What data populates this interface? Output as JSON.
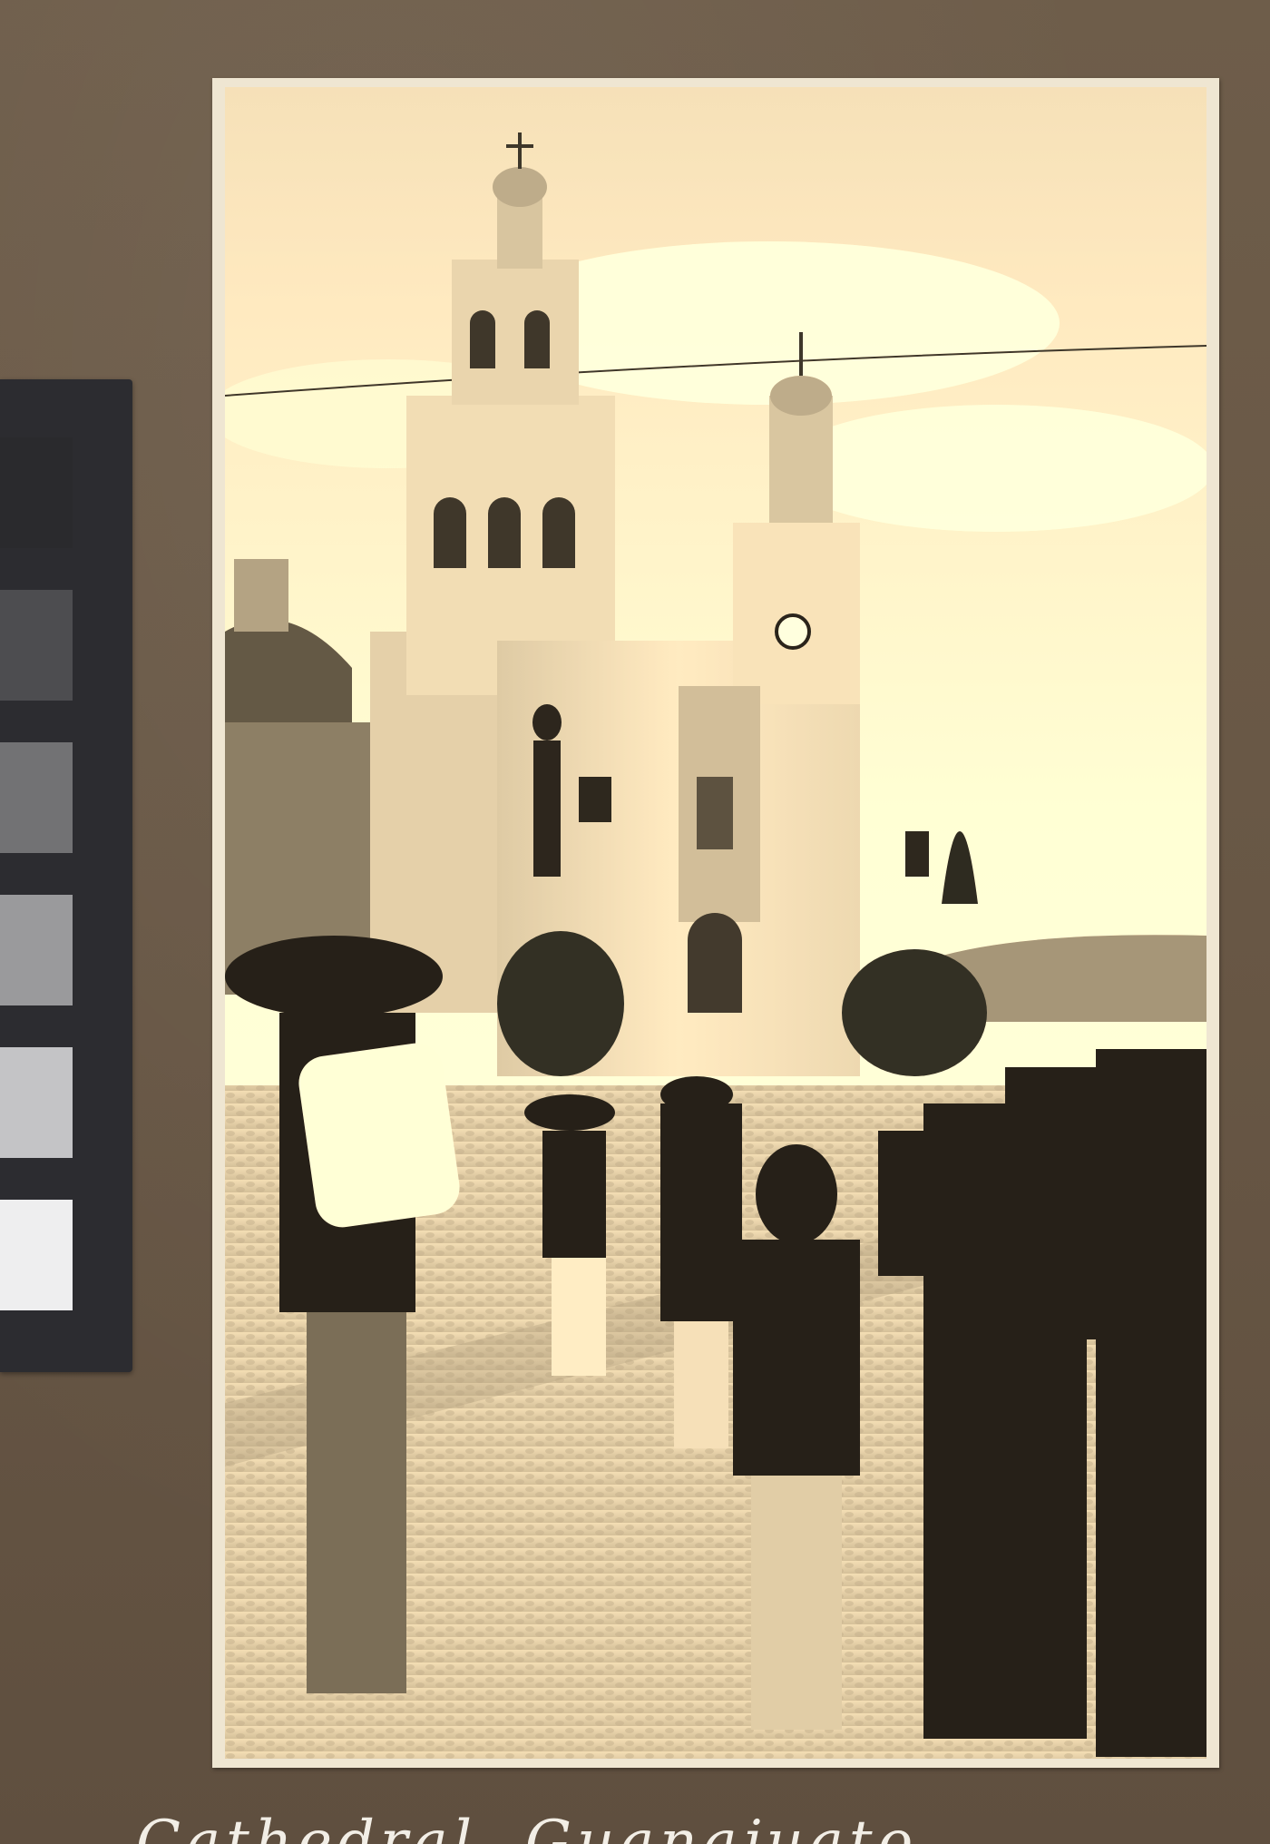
{
  "image": {
    "subject": "sepia-photograph-of-cathedral-plaza",
    "palette": {
      "mount_board": "#6b5a48",
      "photo_paper": "#efe6d2",
      "sepia_light": "#e6dcc4",
      "sepia_mid": "#a89a80",
      "sepia_dark": "#2a241c",
      "checker_frame": "#2c2c30"
    },
    "color_checker": {
      "patches": [
        "#2a2a2d",
        "#4d4d50",
        "#727274",
        "#9a9a9c",
        "#c4c4c6",
        "#eeeeef"
      ]
    },
    "caption_text": "Cathedral, Guanajuato"
  }
}
